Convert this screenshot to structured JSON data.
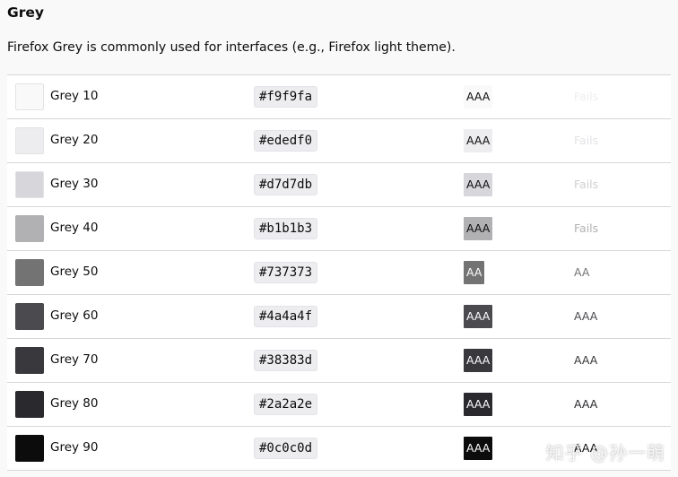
{
  "title": "Grey",
  "description": "Firefox Grey is commonly used for interfaces (e.g., Firefox light theme).",
  "rows": [
    {
      "name": "Grey 10",
      "hex": "#f9f9fa",
      "color": "#f9f9fa",
      "badge": "AAA",
      "badge_fg": "#0c0c0d",
      "rating": "Fails",
      "rating_color": "#ededf0"
    },
    {
      "name": "Grey 20",
      "hex": "#ededf0",
      "color": "#ededf0",
      "badge": "AAA",
      "badge_fg": "#0c0c0d",
      "rating": "Fails",
      "rating_color": "#e3e3e6"
    },
    {
      "name": "Grey 30",
      "hex": "#d7d7db",
      "color": "#d7d7db",
      "badge": "AAA",
      "badge_fg": "#0c0c0d",
      "rating": "Fails",
      "rating_color": "#cfcfd3"
    },
    {
      "name": "Grey 40",
      "hex": "#b1b1b3",
      "color": "#b1b1b3",
      "badge": "AAA",
      "badge_fg": "#0c0c0d",
      "rating": "Fails",
      "rating_color": "#b1b1b3"
    },
    {
      "name": "Grey 50",
      "hex": "#737373",
      "color": "#737373",
      "badge": "AA",
      "badge_fg": "#ffffff",
      "rating": "AA",
      "rating_color": "#737373"
    },
    {
      "name": "Grey 60",
      "hex": "#4a4a4f",
      "color": "#4a4a4f",
      "badge": "AAA",
      "badge_fg": "#ffffff",
      "rating": "AAA",
      "rating_color": "#4a4a4f"
    },
    {
      "name": "Grey 70",
      "hex": "#38383d",
      "color": "#38383d",
      "badge": "AAA",
      "badge_fg": "#ffffff",
      "rating": "AAA",
      "rating_color": "#38383d"
    },
    {
      "name": "Grey 80",
      "hex": "#2a2a2e",
      "color": "#2a2a2e",
      "badge": "AAA",
      "badge_fg": "#ffffff",
      "rating": "AAA",
      "rating_color": "#2a2a2e"
    },
    {
      "name": "Grey 90",
      "hex": "#0c0c0d",
      "color": "#0c0c0d",
      "badge": "AAA",
      "badge_fg": "#ffffff",
      "rating": "AAA",
      "rating_color": "#0c0c0d"
    }
  ],
  "watermark": "知乎 @孙一萌"
}
